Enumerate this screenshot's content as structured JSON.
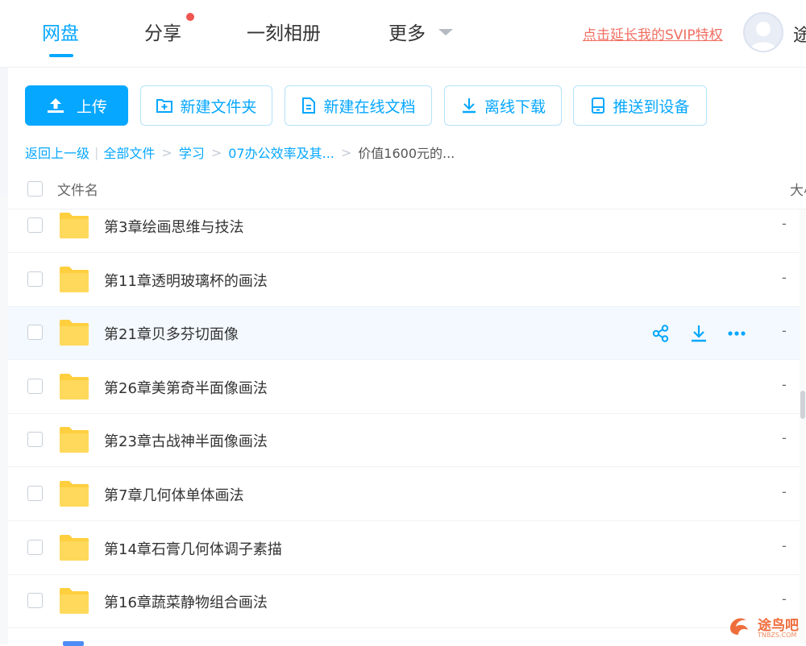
{
  "nav": {
    "tabs": [
      {
        "label": "网盘",
        "active": true
      },
      {
        "label": "分享",
        "has_notification": true
      },
      {
        "label": "一刻相册"
      },
      {
        "label": "更多"
      }
    ],
    "svip_link": "点击延长我的SVIP特权",
    "username": "途"
  },
  "toolbar": {
    "upload": "上传",
    "new_folder": "新建文件夹",
    "new_doc": "新建在线文档",
    "offline_download": "离线下载",
    "push_device": "推送到设备"
  },
  "breadcrumb": {
    "back": "返回上一级",
    "items": [
      "全部文件",
      "学习",
      "07办公效率及其...",
      "价值1600元的..."
    ]
  },
  "table": {
    "col_name": "文件名",
    "col_size": "大小",
    "rows": [
      {
        "name": "第3章绘画思维与技法",
        "size": "-"
      },
      {
        "name": "第11章透明玻璃杯的画法",
        "size": "-"
      },
      {
        "name": "第21章贝多芬切面像",
        "size": "-",
        "hovered": true
      },
      {
        "name": "第26章美第奇半面像画法",
        "size": "-"
      },
      {
        "name": "第23章古战神半面像画法",
        "size": "-"
      },
      {
        "name": "第7章几何体单体画法",
        "size": "-"
      },
      {
        "name": "第14章石膏几何体调子素描",
        "size": "-"
      },
      {
        "name": "第16章蔬菜静物组合画法",
        "size": "-"
      }
    ]
  },
  "watermark": {
    "text": "途鸟吧",
    "sub": "TNBZS.COM"
  },
  "colors": {
    "accent": "#06a7ff",
    "folder": "#ffd54f",
    "svip": "#f06e61"
  }
}
